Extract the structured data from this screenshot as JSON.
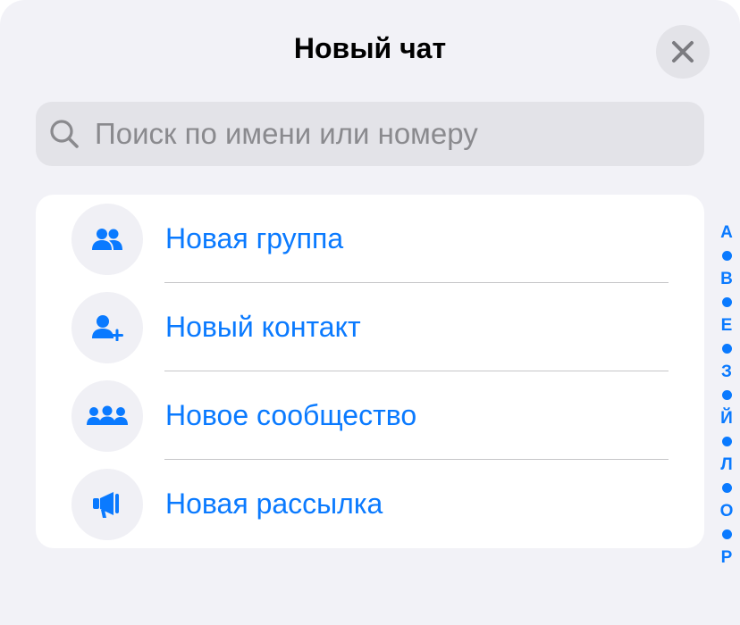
{
  "header": {
    "title": "Новый чат",
    "close_icon": "close-icon"
  },
  "search": {
    "placeholder": "Поиск по имени или номеру",
    "value": "",
    "icon": "search-icon"
  },
  "actions": [
    {
      "label": "Новая группа",
      "icon": "group-icon"
    },
    {
      "label": "Новый контакт",
      "icon": "add-contact-icon"
    },
    {
      "label": "Новое сообщество",
      "icon": "community-icon"
    },
    {
      "label": "Новая рассылка",
      "icon": "megaphone-icon"
    }
  ],
  "index": {
    "letters": [
      "А",
      "В",
      "Е",
      "З",
      "Й",
      "Л",
      "О",
      "Р"
    ]
  },
  "colors": {
    "accent": "#0a7aff",
    "background": "#f2f2f7",
    "card": "#ffffff",
    "search_fill": "#e3e3e8"
  }
}
